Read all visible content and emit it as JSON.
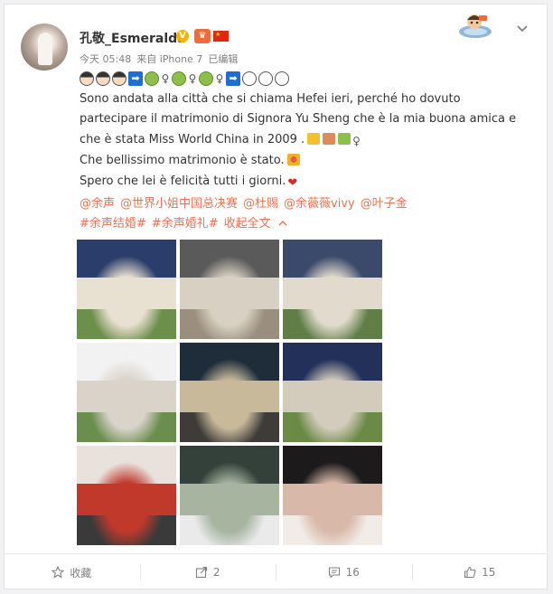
{
  "user": {
    "name": "孔敬_Esmeralda",
    "verified_badge": "V",
    "time": "今天 05:48",
    "source": "来自 iPhone 7",
    "edited": "已编辑"
  },
  "post": {
    "line1": "Sono andata alla città che si chiama Hefei ieri, perché ho dovuto partecipare il matrimonio di Signora Yu Sheng che è la mia buona amica e che è stata Miss World China in 2009 .",
    "line2": "Che  bellissimo matrimonio è stato.",
    "line3": "Spero che lei è felicità tutti i giorni."
  },
  "tags": {
    "mentions": [
      "@余声",
      "@世界小姐中国总决赛",
      "@杜赐",
      "@余薇薇vivy",
      "@叶子金"
    ],
    "hashtags": [
      "#余声结婚#",
      "#余声婚礼#"
    ],
    "collapse_label": "收起全文",
    "collapse_icon": "chevron-up-icon"
  },
  "photos": [
    {
      "name": "photo-bridesmaids-group-1",
      "palette": [
        "#2b3d6b",
        "#e8e0d0",
        "#6d8f4c"
      ]
    },
    {
      "name": "photo-bridesmaids-group-2",
      "palette": [
        "#5a5a5a",
        "#d8d0c2",
        "#9a8f7e"
      ]
    },
    {
      "name": "photo-bridesmaids-group-3",
      "palette": [
        "#3b4a6b",
        "#e2dbcd",
        "#5f7f47"
      ]
    },
    {
      "name": "photo-bride-alone-stage",
      "palette": [
        "#f2f2f2",
        "#d9d3c9",
        "#6b8e4e"
      ]
    },
    {
      "name": "photo-groom-and-bridesmaids",
      "palette": [
        "#1f2d3a",
        "#c9b99b",
        "#3e3b38"
      ]
    },
    {
      "name": "photo-bridesmaids-group-4",
      "palette": [
        "#23305a",
        "#d3cbbb",
        "#6b8a46"
      ]
    },
    {
      "name": "photo-groom-red-room",
      "palette": [
        "#e9e1dc",
        "#c0392b",
        "#3a3a3a"
      ]
    },
    {
      "name": "photo-flower-tunnel-ceremony",
      "palette": [
        "#33413a",
        "#a6b4a0",
        "#eaeaea"
      ]
    },
    {
      "name": "photo-couple-closeup",
      "palette": [
        "#1c1a1a",
        "#d8b8a8",
        "#f1ece8"
      ]
    }
  ],
  "actions": {
    "favorite_label": "收藏",
    "share_count": "2",
    "comment_count": "16",
    "like_count": "15"
  },
  "colors": {
    "link": "#eb7350",
    "text": "#333333",
    "muted": "#808080",
    "verified": "#f7b300"
  }
}
